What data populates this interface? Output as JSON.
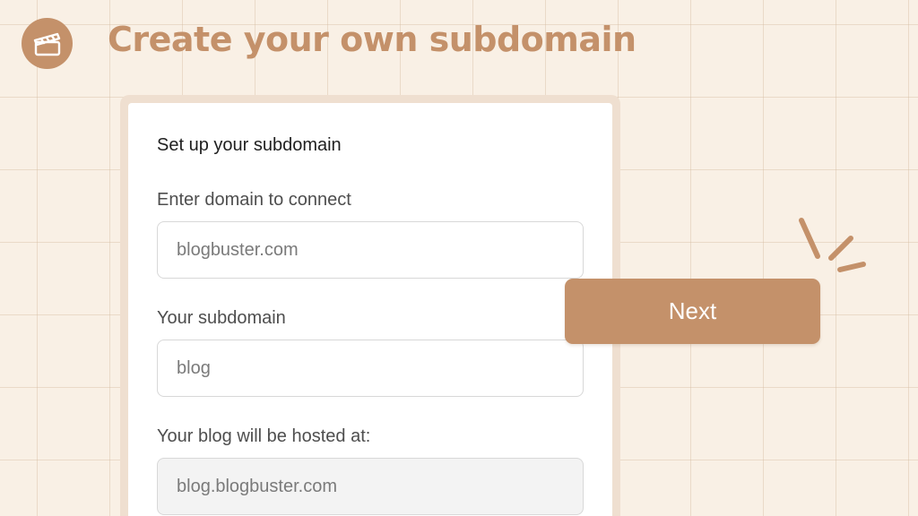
{
  "header": {
    "logo_icon": "clapperboard-icon",
    "title": "Create your own subdomain"
  },
  "form": {
    "heading": "Set up your subdomain",
    "domain_label": "Enter domain to connect",
    "domain_value": "blogbuster.com",
    "subdomain_label": "Your subdomain",
    "subdomain_value": "blog",
    "hosted_label": "Your blog will be hosted at:",
    "hosted_value": "blog.blogbuster.com"
  },
  "actions": {
    "next_label": "Next"
  },
  "decor": {
    "sparkle_icon": "sparkle-lines-icon"
  },
  "colors": {
    "accent": "#c4916a",
    "background": "#f9f0e5",
    "card_border": "#efdfd0"
  }
}
